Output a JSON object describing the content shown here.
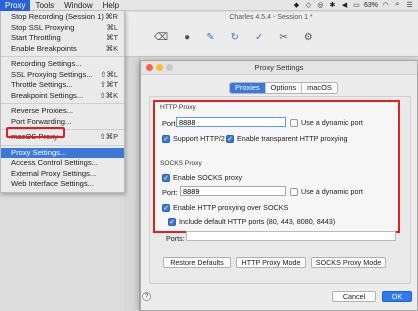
{
  "menubar": {
    "items": [
      "Proxy",
      "Tools",
      "Window",
      "Help"
    ],
    "active": "Proxy",
    "status": {
      "battery": "63%",
      "icons": [
        "wifi-icon",
        "spotlight-icon",
        "menu-list-icon"
      ]
    }
  },
  "menu": {
    "items": [
      {
        "label": "Stop Recording (Session 1)",
        "shortcut": "⌘R"
      },
      {
        "label": "Stop SSL Proxying",
        "shortcut": "⌘L"
      },
      {
        "label": "Start Throttling",
        "shortcut": "⌘T"
      },
      {
        "label": "Enable Breakpoints",
        "shortcut": "⌘K"
      },
      {
        "label": "Recording Settings...",
        "shortcut": ""
      },
      {
        "label": "SSL Proxying Settings...",
        "shortcut": "⇧⌘L"
      },
      {
        "label": "Throttle Settings...",
        "shortcut": "⇧⌘T"
      },
      {
        "label": "Breakpoint Settings...",
        "shortcut": "⇧⌘K"
      },
      {
        "label": "Reverse Proxies...",
        "shortcut": ""
      },
      {
        "label": "Port Forwarding...",
        "shortcut": ""
      },
      {
        "label": "macOS Proxy",
        "shortcut": "⇧⌘P"
      },
      {
        "label": "Proxy Settings...",
        "shortcut": ""
      },
      {
        "label": "Access Control Settings...",
        "shortcut": ""
      },
      {
        "label": "External Proxy Settings...",
        "shortcut": ""
      },
      {
        "label": "Web Interface Settings...",
        "shortcut": ""
      }
    ]
  },
  "main_window": {
    "title": "Charles 4.5.4 - Session 1 *"
  },
  "dialog": {
    "title": "Proxy Settings",
    "tabs": [
      "Proxies",
      "Options",
      "macOS"
    ],
    "http_group": "HTTP Proxy",
    "http_port_label": "Port:",
    "http_port_value": "8888",
    "http_dynamic": "Use a dynamic port",
    "support_http2": "Support HTTP/2",
    "transparent": "Enable transparent HTTP proxying",
    "socks_group": "SOCKS Proxy",
    "enable_socks": "Enable SOCKS proxy",
    "socks_port_label": "Port:",
    "socks_port_value": "8889",
    "socks_dynamic": "Use a dynamic port",
    "http_over_socks": "Enable HTTP proxying over SOCKS",
    "default_ports": "Include default HTTP ports (80, 443, 8080, 8443)",
    "ports_label": "Ports:",
    "restore_defaults": "Restore Defaults",
    "http_mode": "HTTP Proxy Mode",
    "socks_mode": "SOCKS Proxy Mode",
    "help": "?",
    "cancel": "Cancel",
    "ok": "OK"
  },
  "colors": {
    "accent": "#3b78d8",
    "highlight": "#dd2222"
  }
}
